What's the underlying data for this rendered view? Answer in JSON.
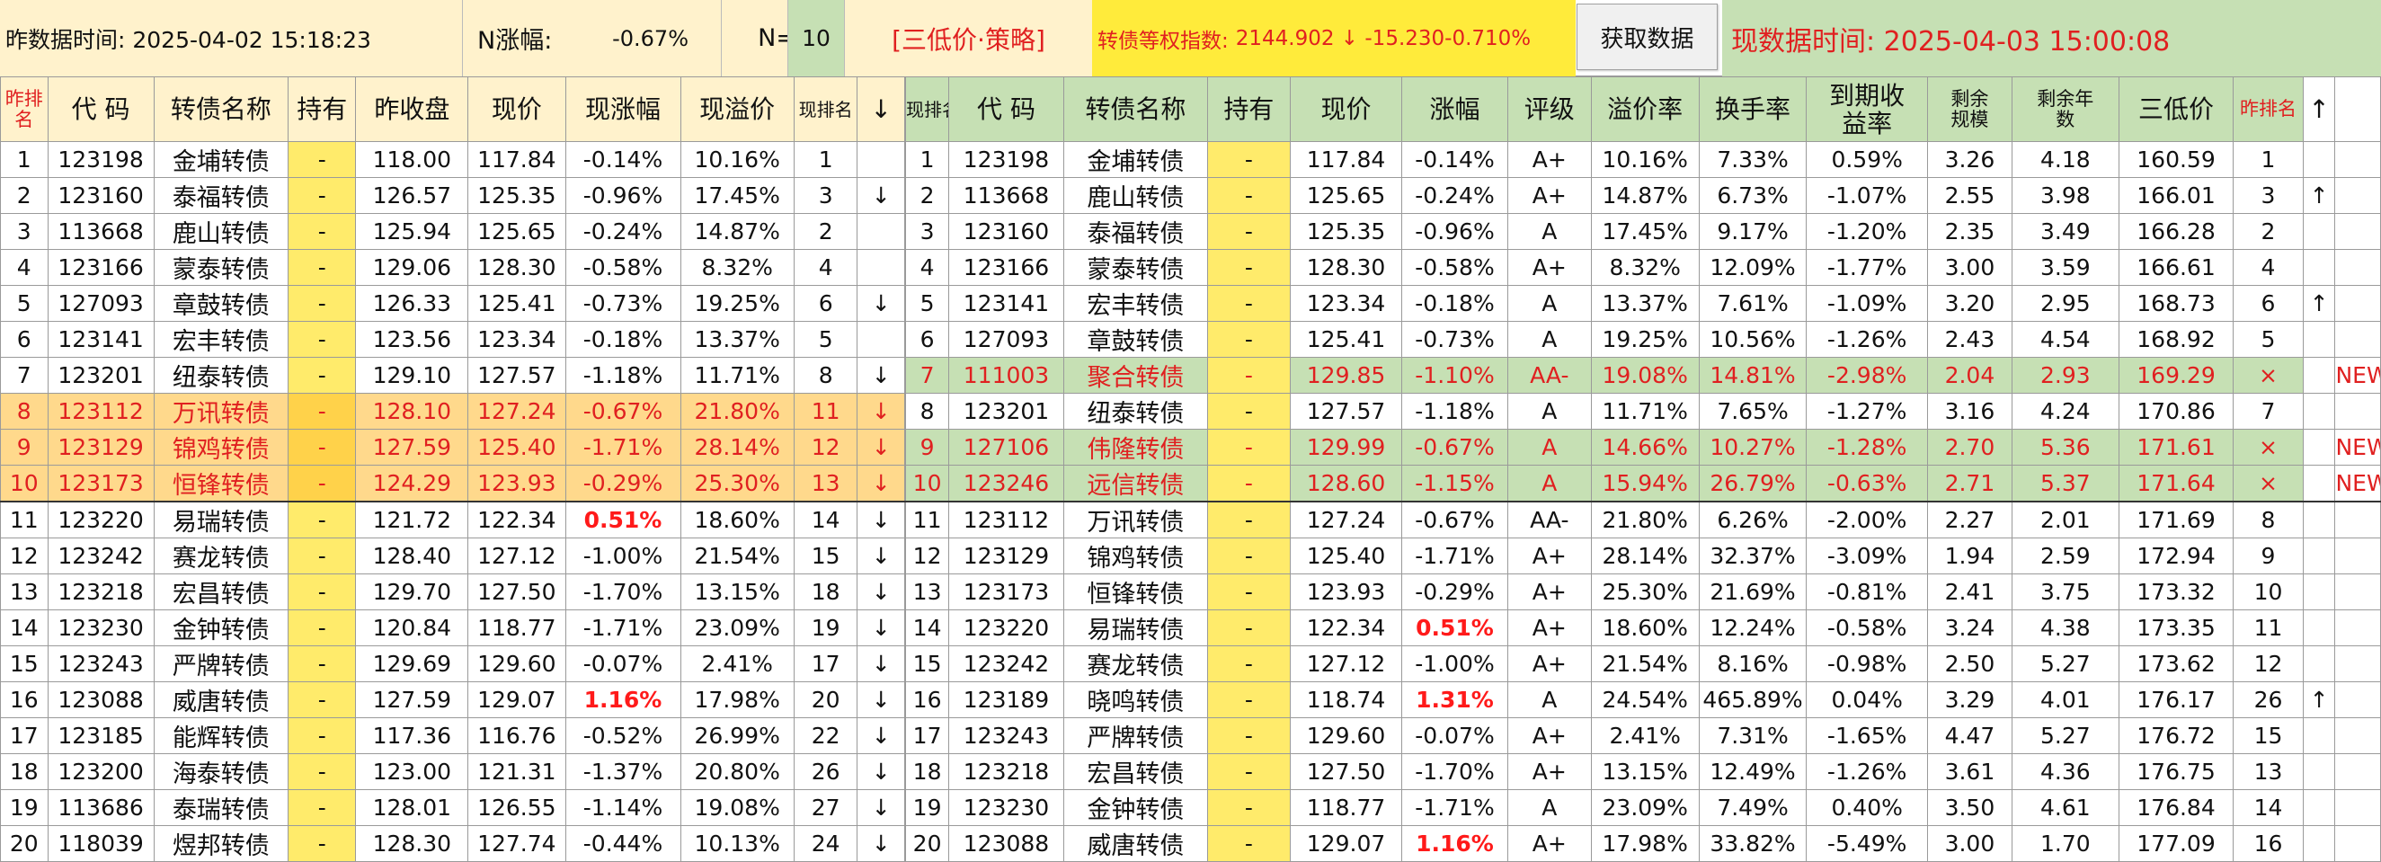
{
  "header": {
    "prev_time": "昨数据时间: 2025-04-02 15:18:23",
    "n_change_label": "N涨幅:",
    "n_change_value": "-0.67%",
    "n_label": "N=",
    "n_value": "10",
    "strategy": "[三低价·策略]",
    "index_label": "转债等权指数:",
    "index_value": "2144.902 ↓ -15.230-0.710%",
    "fetch_button": "获取数据",
    "current_time": "现数据时间: 2025-04-03 15:00:08"
  },
  "left_table": {
    "headers": [
      "昨排名",
      "代 码",
      "转债名称",
      "持有",
      "昨收盘",
      "现价",
      "现涨幅",
      "现溢价",
      "现排名",
      "↓"
    ],
    "rows": [
      [
        "1",
        "123198",
        "金埔转债",
        "-",
        "118.00",
        "117.84",
        "-0.14%",
        "10.16%",
        "1",
        ""
      ],
      [
        "2",
        "123160",
        "泰福转债",
        "-",
        "126.57",
        "125.35",
        "-0.96%",
        "17.45%",
        "3",
        "↓"
      ],
      [
        "3",
        "113668",
        "鹿山转债",
        "-",
        "125.94",
        "125.65",
        "-0.24%",
        "14.87%",
        "2",
        ""
      ],
      [
        "4",
        "123166",
        "蒙泰转债",
        "-",
        "129.06",
        "128.30",
        "-0.58%",
        "8.32%",
        "4",
        ""
      ],
      [
        "5",
        "127093",
        "章鼓转债",
        "-",
        "126.33",
        "125.41",
        "-0.73%",
        "19.25%",
        "6",
        "↓"
      ],
      [
        "6",
        "123141",
        "宏丰转债",
        "-",
        "123.56",
        "123.34",
        "-0.18%",
        "13.37%",
        "5",
        ""
      ],
      [
        "7",
        "123201",
        "纽泰转债",
        "-",
        "129.10",
        "127.57",
        "-1.18%",
        "11.71%",
        "8",
        "↓"
      ],
      [
        "8",
        "123112",
        "万讯转债",
        "-",
        "128.10",
        "127.24",
        "-0.67%",
        "21.80%",
        "11",
        "↓"
      ],
      [
        "9",
        "123129",
        "锦鸡转债",
        "-",
        "127.59",
        "125.40",
        "-1.71%",
        "28.14%",
        "12",
        "↓"
      ],
      [
        "10",
        "123173",
        "恒锋转债",
        "-",
        "124.29",
        "123.93",
        "-0.29%",
        "25.30%",
        "13",
        "↓"
      ],
      [
        "11",
        "123220",
        "易瑞转债",
        "-",
        "121.72",
        "122.34",
        "0.51%",
        "18.60%",
        "14",
        "↓"
      ],
      [
        "12",
        "123242",
        "赛龙转债",
        "-",
        "128.40",
        "127.12",
        "-1.00%",
        "21.54%",
        "15",
        "↓"
      ],
      [
        "13",
        "123218",
        "宏昌转债",
        "-",
        "129.70",
        "127.50",
        "-1.70%",
        "13.15%",
        "18",
        "↓"
      ],
      [
        "14",
        "123230",
        "金钟转债",
        "-",
        "120.84",
        "118.77",
        "-1.71%",
        "23.09%",
        "19",
        "↓"
      ],
      [
        "15",
        "123243",
        "严牌转债",
        "-",
        "129.69",
        "129.60",
        "-0.07%",
        "2.41%",
        "17",
        "↓"
      ],
      [
        "16",
        "123088",
        "威唐转债",
        "-",
        "127.59",
        "129.07",
        "1.16%",
        "17.98%",
        "20",
        "↓"
      ],
      [
        "17",
        "123185",
        "能辉转债",
        "-",
        "117.36",
        "116.76",
        "-0.52%",
        "26.99%",
        "22",
        "↓"
      ],
      [
        "18",
        "123200",
        "海泰转债",
        "-",
        "123.00",
        "121.31",
        "-1.37%",
        "20.80%",
        "26",
        "↓"
      ],
      [
        "19",
        "113686",
        "泰瑞转债",
        "-",
        "128.01",
        "126.55",
        "-1.14%",
        "19.08%",
        "27",
        "↓"
      ],
      [
        "20",
        "118039",
        "煜邦转债",
        "-",
        "128.30",
        "127.74",
        "-0.44%",
        "10.13%",
        "24",
        "↓"
      ]
    ]
  },
  "right_table": {
    "headers": [
      "现排名",
      "代 码",
      "转债名称",
      "持有",
      "现价",
      "涨幅",
      "评级",
      "溢价率",
      "换手率",
      "到期收益率",
      "剩余规模",
      "剩余年数",
      "三低价",
      "昨排名",
      "↑"
    ],
    "rows": [
      [
        "1",
        "123198",
        "金埔转债",
        "-",
        "117.84",
        "-0.14%",
        "A+",
        "10.16%",
        "7.33%",
        "0.59%",
        "3.26",
        "4.18",
        "160.59",
        "1",
        "",
        ""
      ],
      [
        "2",
        "113668",
        "鹿山转债",
        "-",
        "125.65",
        "-0.24%",
        "A+",
        "14.87%",
        "6.73%",
        "-1.07%",
        "2.55",
        "3.98",
        "166.01",
        "3",
        "↑",
        ""
      ],
      [
        "3",
        "123160",
        "泰福转债",
        "-",
        "125.35",
        "-0.96%",
        "A",
        "17.45%",
        "9.17%",
        "-1.20%",
        "2.35",
        "3.49",
        "166.28",
        "2",
        "",
        ""
      ],
      [
        "4",
        "123166",
        "蒙泰转债",
        "-",
        "128.30",
        "-0.58%",
        "A+",
        "8.32%",
        "12.09%",
        "-1.77%",
        "3.00",
        "3.59",
        "166.61",
        "4",
        "",
        ""
      ],
      [
        "5",
        "123141",
        "宏丰转债",
        "-",
        "123.34",
        "-0.18%",
        "A",
        "13.37%",
        "7.61%",
        "-1.09%",
        "3.20",
        "2.95",
        "168.73",
        "6",
        "↑",
        ""
      ],
      [
        "6",
        "127093",
        "章鼓转债",
        "-",
        "125.41",
        "-0.73%",
        "A",
        "19.25%",
        "10.56%",
        "-1.26%",
        "2.43",
        "4.54",
        "168.92",
        "5",
        "",
        ""
      ],
      [
        "7",
        "111003",
        "聚合转债",
        "-",
        "129.85",
        "-1.10%",
        "AA-",
        "19.08%",
        "14.81%",
        "-2.98%",
        "2.04",
        "2.93",
        "169.29",
        "×",
        "",
        "NEW"
      ],
      [
        "8",
        "123201",
        "纽泰转债",
        "-",
        "127.57",
        "-1.18%",
        "A",
        "11.71%",
        "7.65%",
        "-1.27%",
        "3.16",
        "4.24",
        "170.86",
        "7",
        "",
        ""
      ],
      [
        "9",
        "127106",
        "伟隆转债",
        "-",
        "129.99",
        "-0.67%",
        "A",
        "14.66%",
        "10.27%",
        "-1.28%",
        "2.70",
        "5.36",
        "171.61",
        "×",
        "",
        "NEW"
      ],
      [
        "10",
        "123246",
        "远信转债",
        "-",
        "128.60",
        "-1.15%",
        "A",
        "15.94%",
        "26.79%",
        "-0.63%",
        "2.71",
        "5.37",
        "171.64",
        "×",
        "",
        "NEW"
      ],
      [
        "11",
        "123112",
        "万讯转债",
        "-",
        "127.24",
        "-0.67%",
        "AA-",
        "21.80%",
        "6.26%",
        "-2.00%",
        "2.27",
        "2.01",
        "171.69",
        "8",
        "",
        ""
      ],
      [
        "12",
        "123129",
        "锦鸡转债",
        "-",
        "125.40",
        "-1.71%",
        "A+",
        "28.14%",
        "32.37%",
        "-3.09%",
        "1.94",
        "2.59",
        "172.94",
        "9",
        "",
        ""
      ],
      [
        "13",
        "123173",
        "恒锋转债",
        "-",
        "123.93",
        "-0.29%",
        "A+",
        "25.30%",
        "21.69%",
        "-0.81%",
        "2.41",
        "3.75",
        "173.32",
        "10",
        "",
        ""
      ],
      [
        "14",
        "123220",
        "易瑞转债",
        "-",
        "122.34",
        "0.51%",
        "A+",
        "18.60%",
        "12.24%",
        "-0.58%",
        "3.24",
        "4.38",
        "173.35",
        "11",
        "",
        ""
      ],
      [
        "15",
        "123242",
        "赛龙转债",
        "-",
        "127.12",
        "-1.00%",
        "A+",
        "21.54%",
        "8.16%",
        "-0.98%",
        "2.50",
        "5.27",
        "173.62",
        "12",
        "",
        ""
      ],
      [
        "16",
        "123189",
        "晓鸣转债",
        "-",
        "118.74",
        "1.31%",
        "A",
        "24.54%",
        "465.89%",
        "0.04%",
        "3.29",
        "4.01",
        "176.17",
        "26",
        "↑",
        ""
      ],
      [
        "17",
        "123243",
        "严牌转债",
        "-",
        "129.60",
        "-0.07%",
        "A+",
        "2.41%",
        "7.31%",
        "-1.65%",
        "4.47",
        "5.27",
        "176.72",
        "15",
        "",
        ""
      ],
      [
        "18",
        "123218",
        "宏昌转债",
        "-",
        "127.50",
        "-1.70%",
        "A+",
        "13.15%",
        "12.49%",
        "-1.26%",
        "3.61",
        "4.36",
        "176.75",
        "13",
        "",
        ""
      ],
      [
        "19",
        "123230",
        "金钟转债",
        "-",
        "118.77",
        "-1.71%",
        "A",
        "23.09%",
        "7.49%",
        "0.40%",
        "3.50",
        "4.61",
        "176.84",
        "14",
        "",
        ""
      ],
      [
        "20",
        "123088",
        "威唐转债",
        "-",
        "129.07",
        "1.16%",
        "A+",
        "17.98%",
        "33.82%",
        "-5.49%",
        "3.00",
        "1.70",
        "177.09",
        "16",
        "",
        ""
      ]
    ]
  },
  "colors": {
    "header_yellow": "#fff2cc",
    "header_green": "#c6e0b4",
    "hold_yellow": "#ffeb6b",
    "highlight_orange": "#ffd98c",
    "accent_red": "#e02020",
    "index_yellow": "#ffeb3b"
  }
}
